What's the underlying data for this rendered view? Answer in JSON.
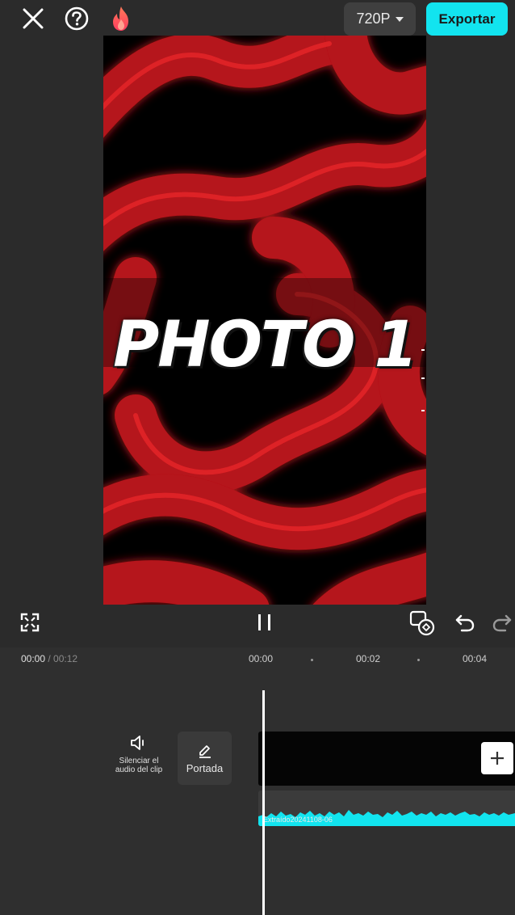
{
  "topbar": {
    "resolution": "720P",
    "export_label": "Exportar"
  },
  "preview": {
    "title_text": "PHOTO 1"
  },
  "timeline": {
    "current_time": "00:00",
    "separator": " / ",
    "total_time": "00:12",
    "ruler": [
      "00:00",
      "00:02",
      "00:04"
    ],
    "mute_label": "Silenciar el audio del clip",
    "cover_label": "Portada",
    "audio_clip_name": "Extraído20241108-06"
  },
  "colors": {
    "accent": "#12e4ef",
    "background": "#2b2b2b",
    "waveform": "#12e4ef",
    "preview_red": "#c4161c"
  },
  "icons": [
    "close-icon",
    "help-icon",
    "fire-icon",
    "caret-down-icon",
    "fullscreen-icon",
    "pause-icon",
    "keyframe-icon",
    "undo-icon",
    "redo-icon",
    "speaker-icon",
    "edit-icon",
    "plus-icon"
  ]
}
